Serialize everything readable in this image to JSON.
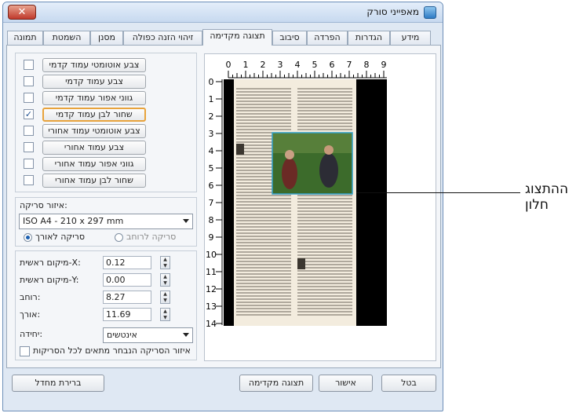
{
  "window": {
    "title": "מאפייני סורק",
    "close_label": "✕"
  },
  "tabs": [
    "מידע",
    "הגדרות",
    "הפרדה",
    "סיבוב",
    "תצוגה מקדימה",
    "זיהוי הזנה כפולה",
    "מסנן",
    "השמטת צבע",
    "תמונה"
  ],
  "active_tab": "תצוגה מקדימה",
  "image_types": [
    {
      "label": "צבע אוטומטי עמוד קדמי",
      "checked": false
    },
    {
      "label": "צבע עמוד קדמי",
      "checked": false
    },
    {
      "label": "גווני אפור עמוד קדמי",
      "checked": false
    },
    {
      "label": "שחור לבן עמוד קדמי",
      "checked": true
    },
    {
      "label": "צבע אוטומטי עמוד אחורי",
      "checked": false
    },
    {
      "label": "צבע עמוד אחורי",
      "checked": false
    },
    {
      "label": "גווני אפור עמוד אחורי",
      "checked": false
    },
    {
      "label": "שחור לבן עמוד אחורי",
      "checked": false
    }
  ],
  "scan_area": {
    "label": "איזור סריקה:",
    "value": "ISO A4 - 210 x 297 mm",
    "radio_landscape": "סריקה לאורך",
    "radio_portrait": "סריקה לרוחב"
  },
  "fields": {
    "x_label": "מיקום ראשית-X:",
    "x_value": "0.12",
    "y_label": "מיקום ראשית-Y:",
    "y_value": "0.00",
    "width_label": "רוחב:",
    "width_value": "8.27",
    "length_label": "אורך:",
    "length_value": "11.69",
    "unit_label": "יחידה:",
    "unit_value": "אינטשים"
  },
  "apply_all_label": "איזור הסריקה הנבחר מתאים לכל הסריקות",
  "ruler": {
    "top": [
      "0",
      "1",
      "2",
      "3",
      "4",
      "5",
      "6",
      "7",
      "8",
      "9"
    ],
    "left": [
      "0",
      "1",
      "2",
      "3",
      "4",
      "5",
      "6",
      "7",
      "8",
      "9",
      "10",
      "11",
      "12",
      "13",
      "14"
    ]
  },
  "buttons": {
    "default": "ברירת מחדל",
    "preview": "תצוגה מקדימה",
    "ok": "אישור",
    "cancel": "בטל"
  },
  "callout": "ההתצוג חלון",
  "colors": {
    "selected_border": "#e8a33c",
    "page_black": "#000000",
    "accent": "#1b5fb0"
  }
}
